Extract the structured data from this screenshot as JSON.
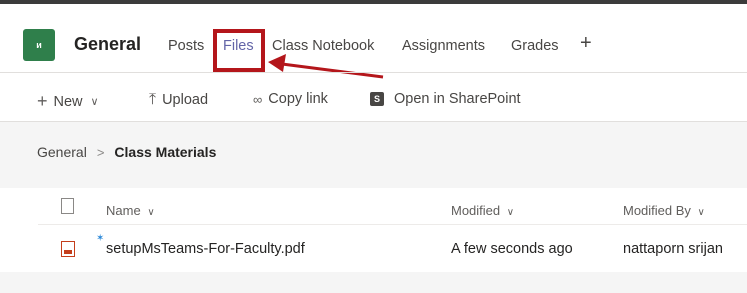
{
  "header": {
    "team_initials": "ᴎ",
    "channel": "General",
    "tabs": [
      {
        "label": "Posts"
      },
      {
        "label": "Files"
      },
      {
        "label": "Class Notebook"
      },
      {
        "label": "Assignments"
      },
      {
        "label": "Grades"
      }
    ],
    "add_tab": "+"
  },
  "toolbar": {
    "new": "New",
    "upload": "Upload",
    "copy_link": "Copy link",
    "open_sharepoint": "Open in SharePoint"
  },
  "breadcrumb": {
    "root": "General",
    "current": "Class Materials"
  },
  "list": {
    "columns": {
      "name": "Name",
      "modified": "Modified",
      "modified_by": "Modified By"
    },
    "rows": [
      {
        "name": "setupMsTeams-For-Faculty.pdf",
        "modified": "A few seconds ago",
        "modified_by": "nattaporn srijan"
      }
    ]
  },
  "colors": {
    "accent": "#6264a7",
    "team_avatar": "#2f7f4b",
    "annotation": "#b4161b"
  }
}
